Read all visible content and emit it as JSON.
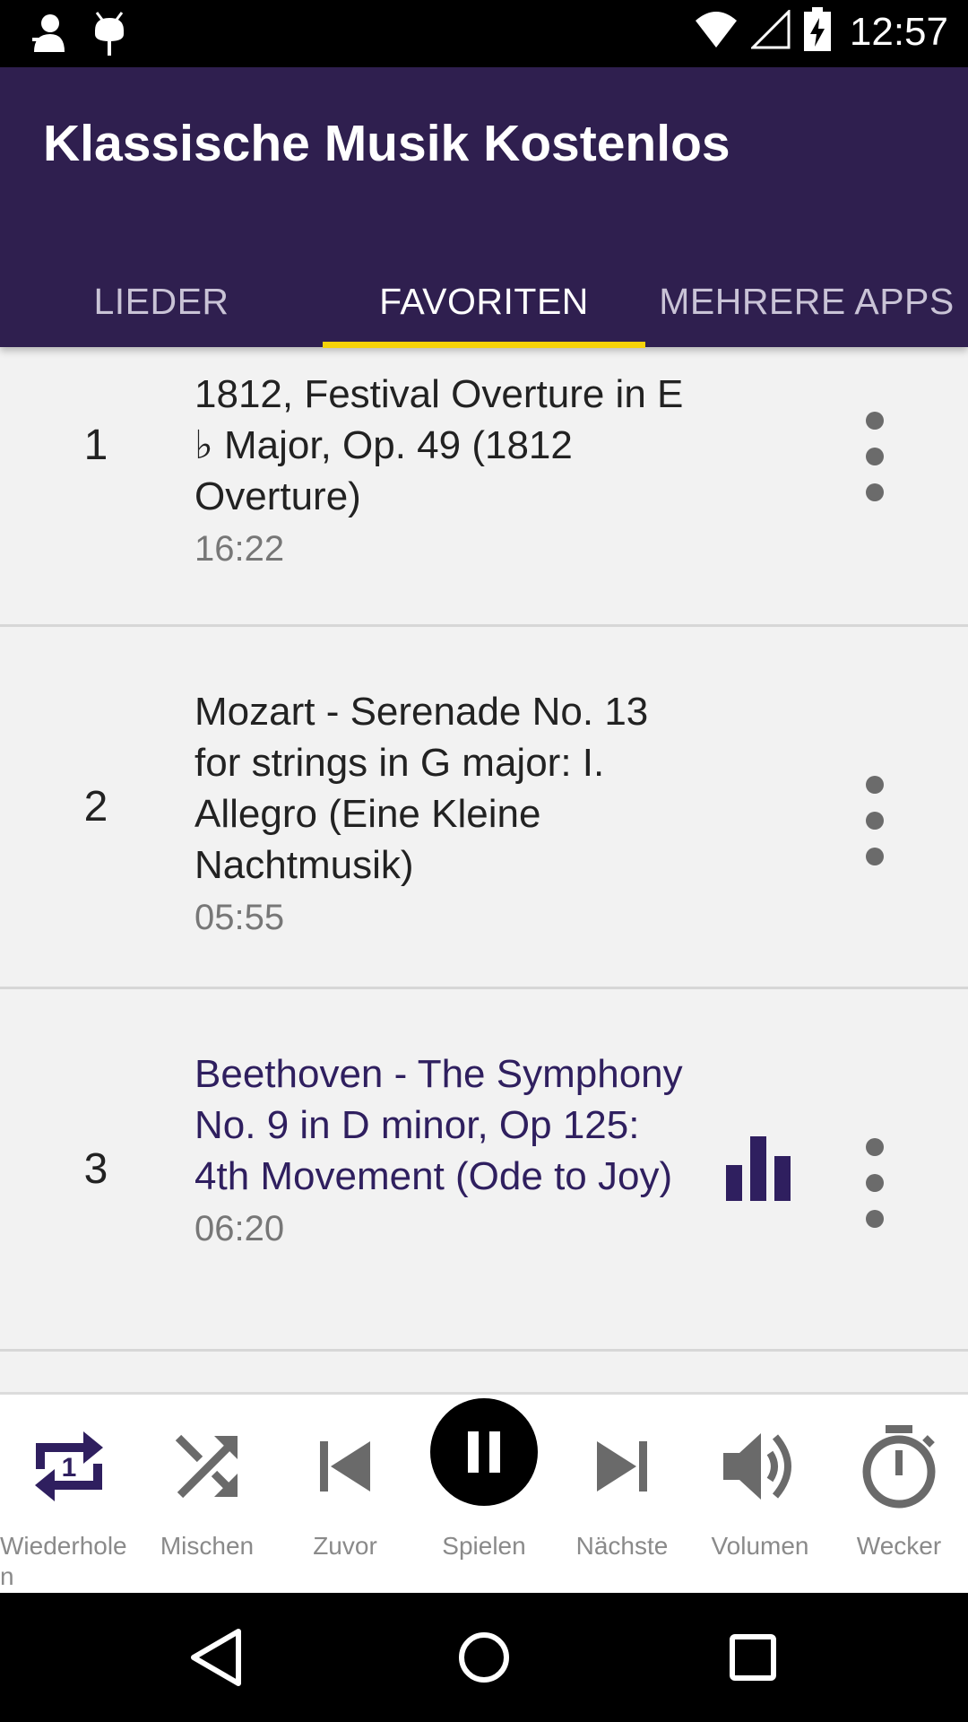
{
  "status_bar": {
    "time": "12:57",
    "left_icons": [
      "notification-person-icon",
      "android-debug-icon"
    ],
    "right_icons": [
      "wifi-icon",
      "signal-icon",
      "battery-charging-icon"
    ]
  },
  "app_bar": {
    "title": "Klassische Musik Kostenlos",
    "tabs": [
      {
        "label": "LIEDER",
        "active": false
      },
      {
        "label": "FAVORITEN",
        "active": true
      },
      {
        "label": "MEHRERE APPS",
        "active": false
      }
    ],
    "color": "#2f1f4f",
    "indicator_color": "#f5d20a"
  },
  "songs": [
    {
      "index": "1",
      "title": "1812, Festival Overture in E ♭ Major, Op. 49 (1812 Overture)",
      "duration": "16:22",
      "playing": false
    },
    {
      "index": "2",
      "title": "Mozart - Serenade No. 13 for strings in G major: I. Allegro (Eine Kleine Nachtmusik)",
      "duration": "05:55",
      "playing": false
    },
    {
      "index": "3",
      "title": "Beethoven - The Symphony No. 9 in D minor, Op 125: 4th Movement (Ode to Joy)",
      "duration": "06:20",
      "playing": true
    }
  ],
  "player": {
    "repeat": {
      "label": "Wiederholen",
      "icon": "repeat-one-icon"
    },
    "shuffle": {
      "label": "Mischen",
      "icon": "shuffle-icon"
    },
    "previous": {
      "label": "Zuvor",
      "icon": "skip-previous-icon"
    },
    "play": {
      "label": "Spielen",
      "icon": "pause-icon"
    },
    "next": {
      "label": "Nächste",
      "icon": "skip-next-icon"
    },
    "volume": {
      "label": "Volumen",
      "icon": "volume-icon"
    },
    "timer": {
      "label": "Wecker",
      "icon": "timer-icon"
    }
  },
  "nav_bar": {
    "icons": [
      "back-icon",
      "home-icon",
      "recents-icon"
    ]
  }
}
